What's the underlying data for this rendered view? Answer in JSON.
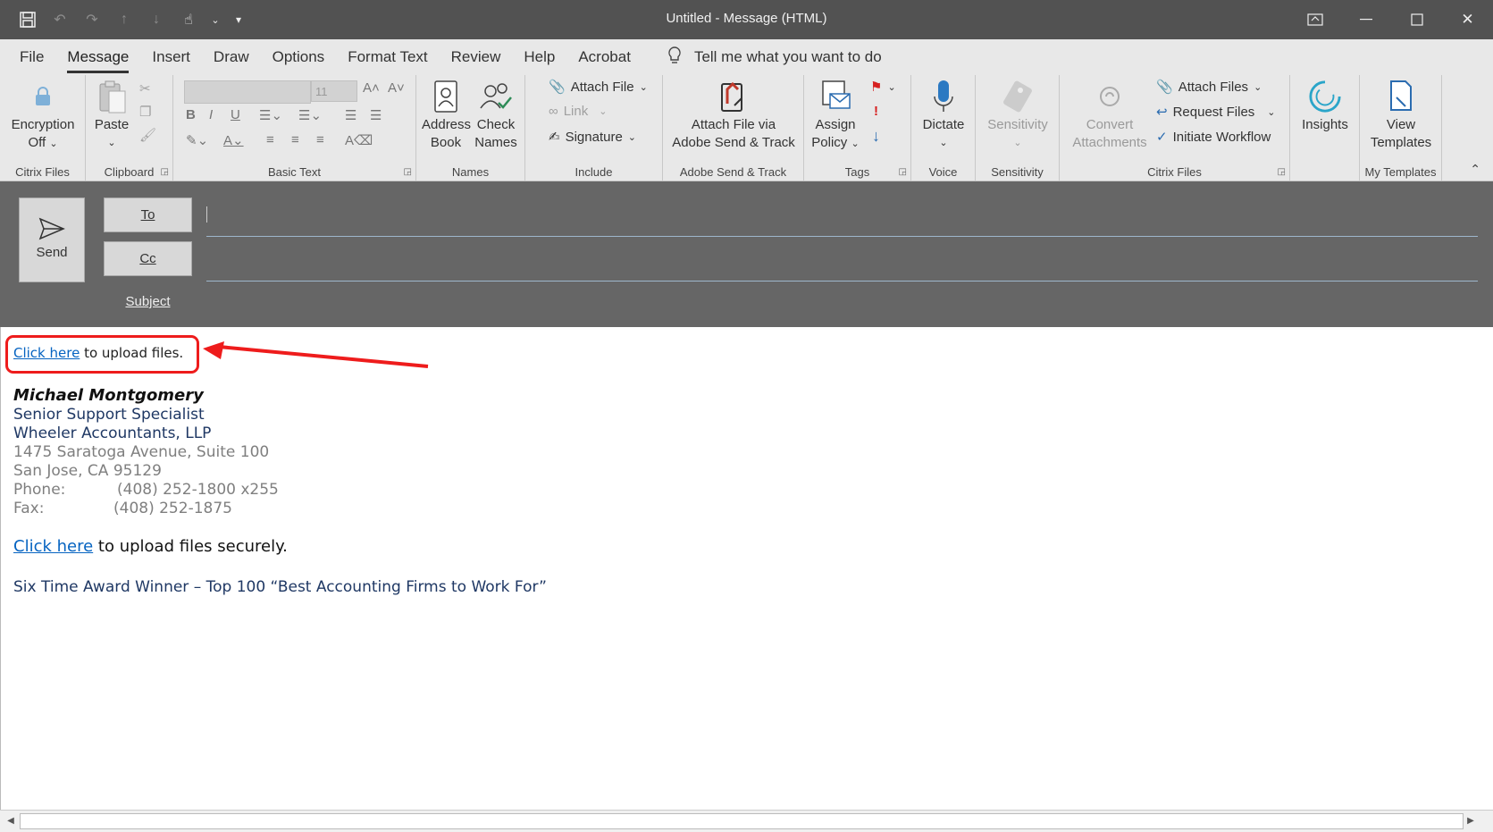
{
  "window": {
    "title": "Untitled  -  Message (HTML)"
  },
  "tabs": [
    "File",
    "Message",
    "Insert",
    "Draw",
    "Options",
    "Format Text",
    "Review",
    "Help",
    "Acrobat"
  ],
  "tell_me": "Tell me what you want to do",
  "ribbon": {
    "citrix": {
      "button_line1": "Encryption",
      "button_line2": "Off",
      "label": "Citrix Files"
    },
    "clipboard": {
      "paste": "Paste",
      "label": "Clipboard"
    },
    "basic_text": {
      "font_size": "11",
      "label": "Basic Text"
    },
    "names": {
      "address_book_1": "Address",
      "address_book_2": "Book",
      "check_names_1": "Check",
      "check_names_2": "Names",
      "label": "Names"
    },
    "include": {
      "attach_file": "Attach File",
      "link": "Link",
      "signature": "Signature",
      "label": "Include"
    },
    "adobe": {
      "line1": "Attach File via",
      "line2": "Adobe Send & Track",
      "label": "Adobe Send & Track"
    },
    "tags": {
      "assign_1": "Assign",
      "assign_2": "Policy",
      "label": "Tags"
    },
    "voice": {
      "dictate": "Dictate",
      "label": "Voice"
    },
    "sensitivity": {
      "button": "Sensitivity",
      "label": "Sensitivity"
    },
    "citrix_files": {
      "convert_1": "Convert",
      "convert_2": "Attachments",
      "attach_files": "Attach Files",
      "request_files": "Request Files",
      "initiate_workflow": "Initiate Workflow",
      "label": "Citrix Files"
    },
    "insights": {
      "button": "Insights"
    },
    "templates": {
      "line1": "View",
      "line2": "Templates",
      "label": "My Templates"
    }
  },
  "compose": {
    "send": "Send",
    "to": "To",
    "cc": "Cc",
    "subject": "Subject"
  },
  "message": {
    "upload_link": "Click here",
    "upload_text": " to upload files.",
    "name": "Michael Montgomery",
    "title": "Senior Support Specialist",
    "company": "Wheeler Accountants, LLP",
    "address1": "1475 Saratoga Avenue, Suite 100",
    "address2": "San Jose, CA 95129",
    "phone_label": "Phone:",
    "phone": "(408) 252-1800 x255",
    "fax_label": "Fax:",
    "fax": "(408) 252-1875",
    "secure_link": "Click here",
    "secure_text": " to upload files securely.",
    "award": "Six Time Award Winner – Top 100 “Best Accounting Firms to Work For”"
  }
}
